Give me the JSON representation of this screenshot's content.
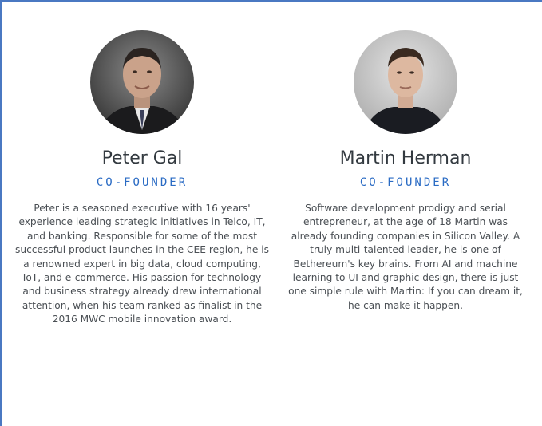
{
  "people": [
    {
      "name": "Peter Gal",
      "role": "CO-FOUNDER",
      "bio": "Peter is a seasoned executive with 16 years' experience leading strategic initiatives in Telco, IT, and banking. Responsible for some of the most successful product launches in the CEE region, he is a renowned expert in big data, cloud computing, IoT, and e-commerce. His passion for technology and business strategy already drew international attention, when his team ranked as finalist in the 2016 MWC mobile innovation award."
    },
    {
      "name": "Martin Herman",
      "role": "CO-FOUNDER",
      "bio": "Software development prodigy and serial entrepreneur, at the age of 18 Martin was already founding companies in Silicon Valley. A truly multi-talented leader, he is one of Bethereum's key brains. From AI and machine learning to UI and graphic design, there is just one simple rule with Martin: If you can dream it, he can make it happen."
    }
  ],
  "colors": {
    "accent": "#2a6bc4",
    "name_text": "#333a40",
    "body_text": "#4a4f54",
    "frame_border": "#4a78c2"
  }
}
